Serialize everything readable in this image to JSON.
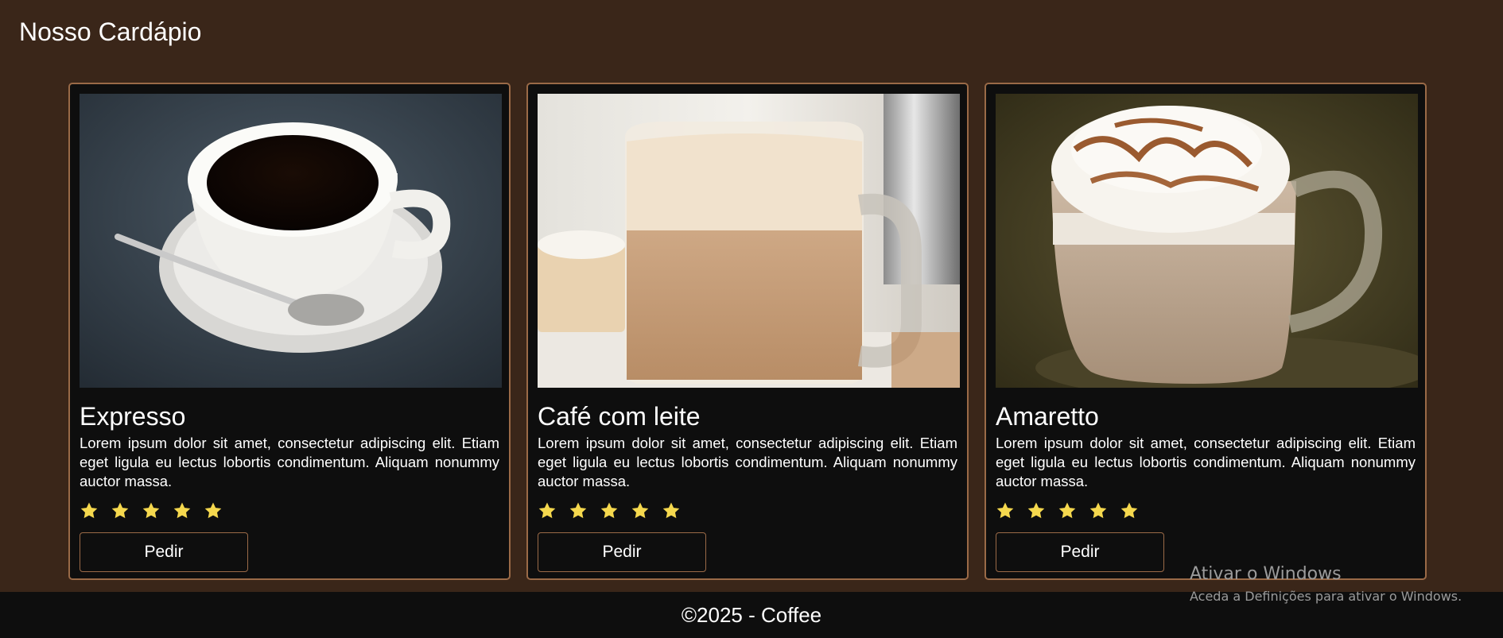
{
  "header": {
    "title": "Nosso Cardápio"
  },
  "colors": {
    "background": "#3a2619",
    "card_background": "#0e0e0e",
    "card_border": "#9a6a47",
    "star": "#f5d84e",
    "footer_background": "#0e0e0e"
  },
  "menu": {
    "items": [
      {
        "name": "Expresso",
        "description": "Lorem ipsum dolor sit amet, consectetur adipiscing elit. Etiam eget ligula eu lectus lobortis condimentum. Aliquam nonummy auctor massa.",
        "rating": 5,
        "button_label": "Pedir",
        "image_icon": "espresso-cup-photo"
      },
      {
        "name": "Café com leite",
        "description": "Lorem ipsum dolor sit amet, consectetur adipiscing elit. Etiam eget ligula eu lectus lobortis condimentum. Aliquam nonummy auctor massa.",
        "rating": 5,
        "button_label": "Pedir",
        "image_icon": "latte-mug-photo"
      },
      {
        "name": "Amaretto",
        "description": "Lorem ipsum dolor sit amet, consectetur adipiscing elit. Etiam eget ligula eu lectus lobortis condimentum. Aliquam nonummy auctor massa.",
        "rating": 5,
        "button_label": "Pedir",
        "image_icon": "amaretto-mug-photo"
      }
    ]
  },
  "footer": {
    "text": "©2025 - Coffee"
  },
  "watermark": {
    "title": "Ativar o Windows",
    "subtitle": "Aceda a Definições para ativar o Windows."
  }
}
